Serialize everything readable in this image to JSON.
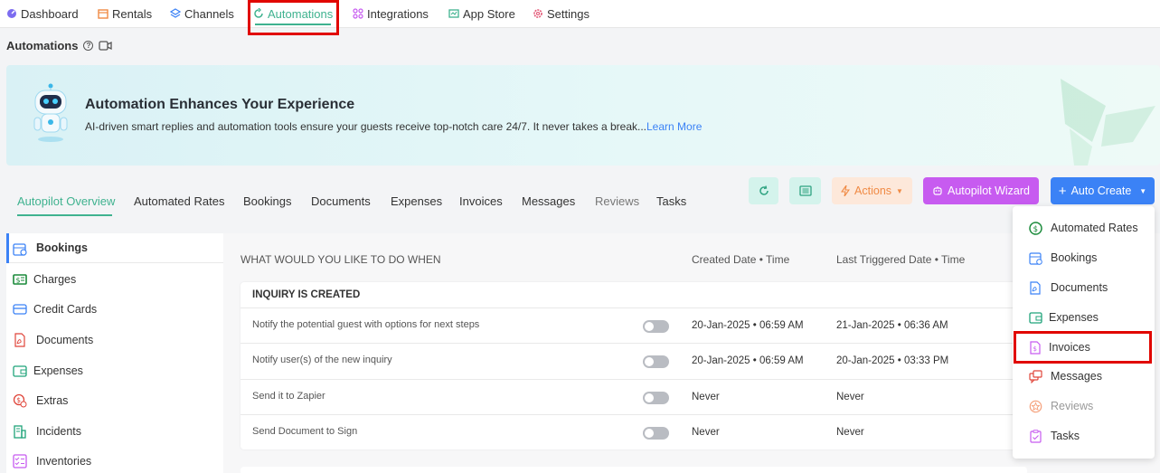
{
  "nav": {
    "items": [
      {
        "label": "Dashboard",
        "icon": "dashboard-icon"
      },
      {
        "label": "Rentals",
        "icon": "rentals-icon"
      },
      {
        "label": "Channels",
        "icon": "channels-icon"
      },
      {
        "label": "Automations",
        "icon": "automations-icon"
      },
      {
        "label": "Integrations",
        "icon": "integrations-icon"
      },
      {
        "label": "App Store",
        "icon": "app-store-icon"
      },
      {
        "label": "Settings",
        "icon": "settings-icon"
      }
    ]
  },
  "page": {
    "title": "Automations"
  },
  "banner": {
    "title": "Automation Enhances Your Experience",
    "text": "AI-driven smart replies and automation tools ensure your guests receive top-notch care 24/7. It never takes a break...",
    "link": "Learn More"
  },
  "tabs": [
    "Autopilot Overview",
    "Automated Rates",
    "Bookings",
    "Documents",
    "Expenses",
    "Invoices",
    "Messages",
    "Reviews",
    "Tasks"
  ],
  "toolbar": {
    "actions_label": "Actions",
    "wizard_label": "Autopilot Wizard",
    "auto_create_label": "Auto Create"
  },
  "sidebar": {
    "items": [
      "Bookings",
      "Charges",
      "Credit Cards",
      "Documents",
      "Expenses",
      "Extras",
      "Incidents",
      "Inventories"
    ]
  },
  "table": {
    "headers": {
      "what": "WHAT WOULD YOU LIKE TO DO WHEN",
      "created": "Created Date • Time",
      "last": "Last Triggered Date • Time"
    },
    "section": "INQUIRY IS CREATED",
    "rows": [
      {
        "desc": "Notify the potential guest with options for next steps",
        "created": "20-Jan-2025 • 06:59 AM",
        "last": "21-Jan-2025 • 06:36 AM"
      },
      {
        "desc": "Notify user(s) of the new inquiry",
        "created": "20-Jan-2025 • 06:59 AM",
        "last": "20-Jan-2025 • 03:33 PM"
      },
      {
        "desc": "Send it to Zapier",
        "created": "Never",
        "last": "Never"
      },
      {
        "desc": "Send Document to Sign",
        "created": "Never",
        "last": "Never"
      }
    ]
  },
  "dropdown": {
    "items": [
      "Automated Rates",
      "Bookings",
      "Documents",
      "Expenses",
      "Invoices",
      "Messages",
      "Reviews",
      "Tasks"
    ]
  },
  "colors": {
    "accent_green": "#3fb28f",
    "primary_blue": "#3b82f6",
    "wizard_purple": "#c75bf0",
    "actions_orange": "#f08a44",
    "highlight_red": "#e10600"
  }
}
